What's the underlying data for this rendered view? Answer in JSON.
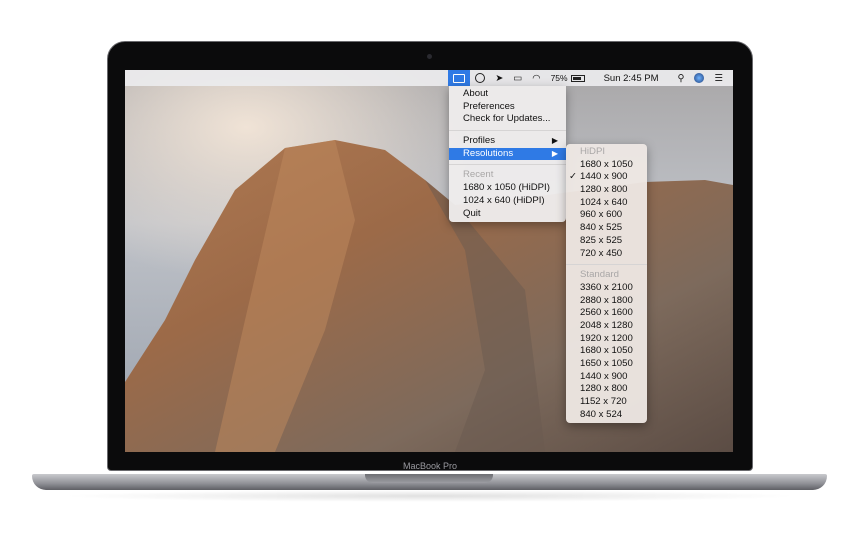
{
  "menubar": {
    "items": [
      {
        "icon": "display-icon"
      },
      {
        "icon": "circle-icon"
      },
      {
        "icon": "location-arrow-icon"
      },
      {
        "icon": "airplay-icon"
      },
      {
        "icon": "wifi-icon"
      }
    ],
    "battery_percent": "75%",
    "clock": "Sun 2:45 PM",
    "accent": "#2f7ae5"
  },
  "app_menu": {
    "items": [
      "About",
      "Preferences",
      "Check for Updates..."
    ],
    "profiles": "Profiles",
    "resolutions": "Resolutions",
    "recent_header": "Recent",
    "recent": [
      "1680 x 1050 (HiDPI)",
      "1024 x 640 (HiDPI)"
    ],
    "quit": "Quit"
  },
  "resolutions_menu": {
    "hidpi_header": "HiDPI",
    "hidpi": [
      "1680 x 1050",
      "1440 x 900",
      "1280 x 800",
      "1024 x 640",
      "960 x 600",
      "840 x 525",
      "825 x 525",
      "720 x 450"
    ],
    "selected": "1440 x 900",
    "check": "✓",
    "standard_header": "Standard",
    "standard": [
      "3360 x 2100",
      "2880 x 1800",
      "2560 x 1600",
      "2048 x 1280",
      "1920 x 1200",
      "1680 x 1050",
      "1650 x 1050",
      "1440 x 900",
      "1280 x 800",
      "1152 x 720",
      "840 x 524"
    ]
  },
  "device": {
    "brand": "MacBook Pro"
  }
}
